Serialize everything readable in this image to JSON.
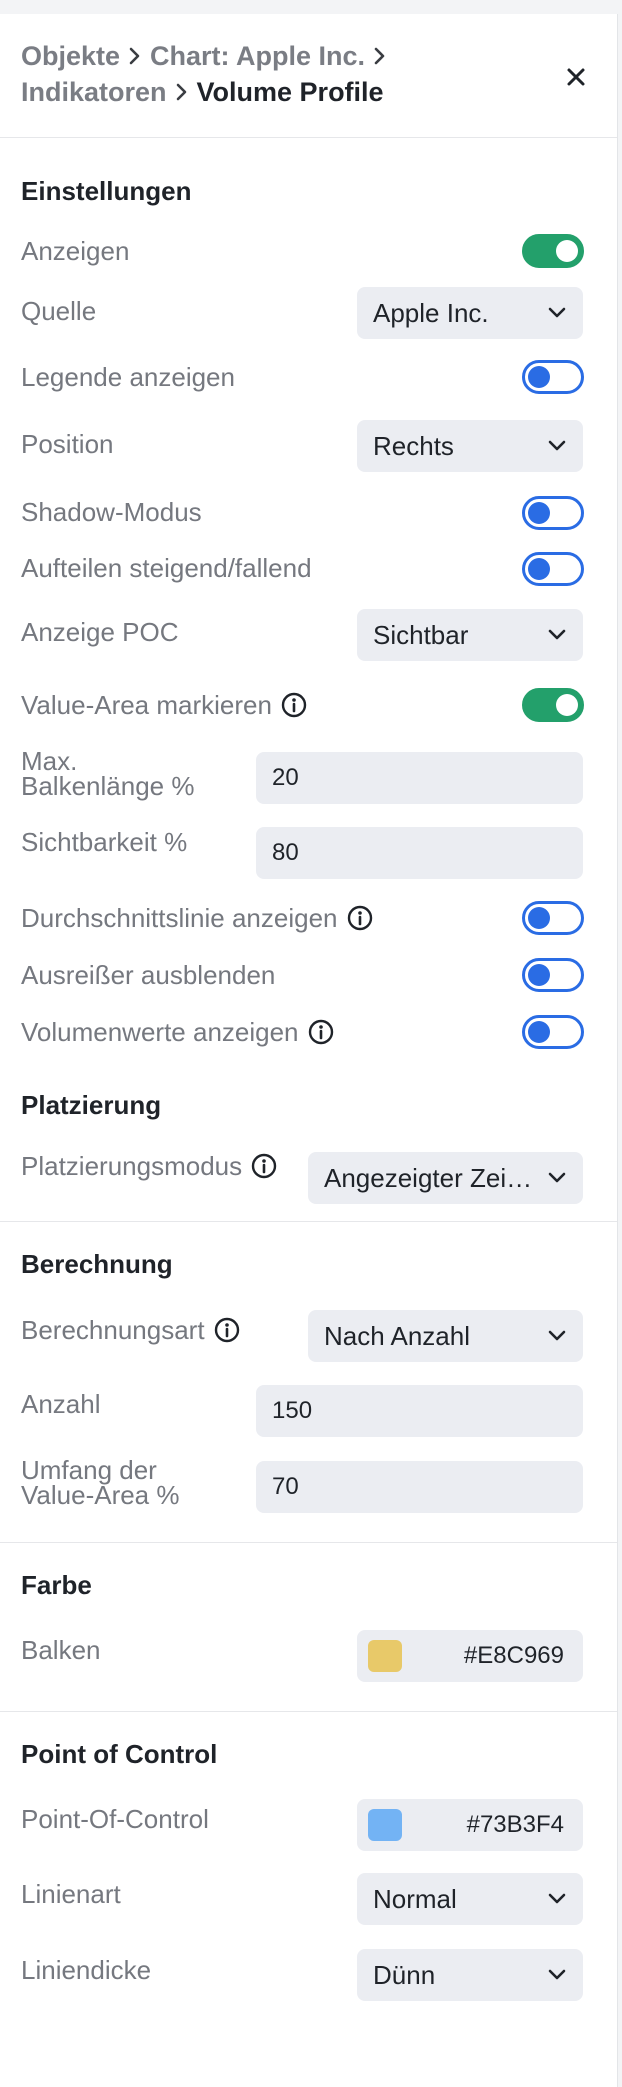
{
  "breadcrumb": {
    "items": [
      "Objekte",
      "Chart: Apple Inc.",
      "Indikatoren"
    ],
    "current": "Volume Profile"
  },
  "colors": {
    "toggle_on": "#23a06b",
    "toggle_off": "#2a6ce4"
  },
  "settings": {
    "title": "Einstellungen",
    "show_label": "Anzeigen",
    "show_on": true,
    "source_label": "Quelle",
    "source_value": "Apple Inc.",
    "legend_label": "Legende anzeigen",
    "legend_on": false,
    "position_label": "Position",
    "position_value": "Rechts",
    "shadow_label": "Shadow-Modus",
    "shadow_on": false,
    "split_label": "Aufteilen steigend/fallend",
    "split_on": false,
    "poc_label": "Anzeige POC",
    "poc_value": "Sichtbar",
    "value_area_label": "Value-Area markieren",
    "value_area_on": true,
    "max_bar_label_1": "Max.",
    "max_bar_label_2": "Balkenlänge %",
    "max_bar_value": "20",
    "visibility_label": "Sichtbarkeit %",
    "visibility_value": "80",
    "avg_line_label": "Durchschnittslinie anzeigen",
    "avg_line_on": false,
    "outliers_label": "Ausreißer ausblenden",
    "outliers_on": false,
    "volume_values_label": "Volumenwerte anzeigen",
    "volume_values_on": false
  },
  "placement": {
    "title": "Platzierung",
    "mode_label": "Platzierungsmodus",
    "mode_value": "Angezeigter Zeitraum"
  },
  "calculation": {
    "title": "Berechnung",
    "type_label": "Berechnungsart",
    "type_value": "Nach Anzahl",
    "count_label": "Anzahl",
    "count_value": "150",
    "va_label_1": "Umfang der",
    "va_label_2": "Value-Area %",
    "va_value": "70"
  },
  "color": {
    "title": "Farbe",
    "bars_label": "Balken",
    "bars_hex": "#E8C969"
  },
  "poc": {
    "title": "Point of Control",
    "poc_label": "Point-Of-Control",
    "poc_hex": "#73B3F4",
    "line_type_label": "Linienart",
    "line_type_value": "Normal",
    "line_width_label": "Liniendicke",
    "line_width_value": "Dünn"
  }
}
